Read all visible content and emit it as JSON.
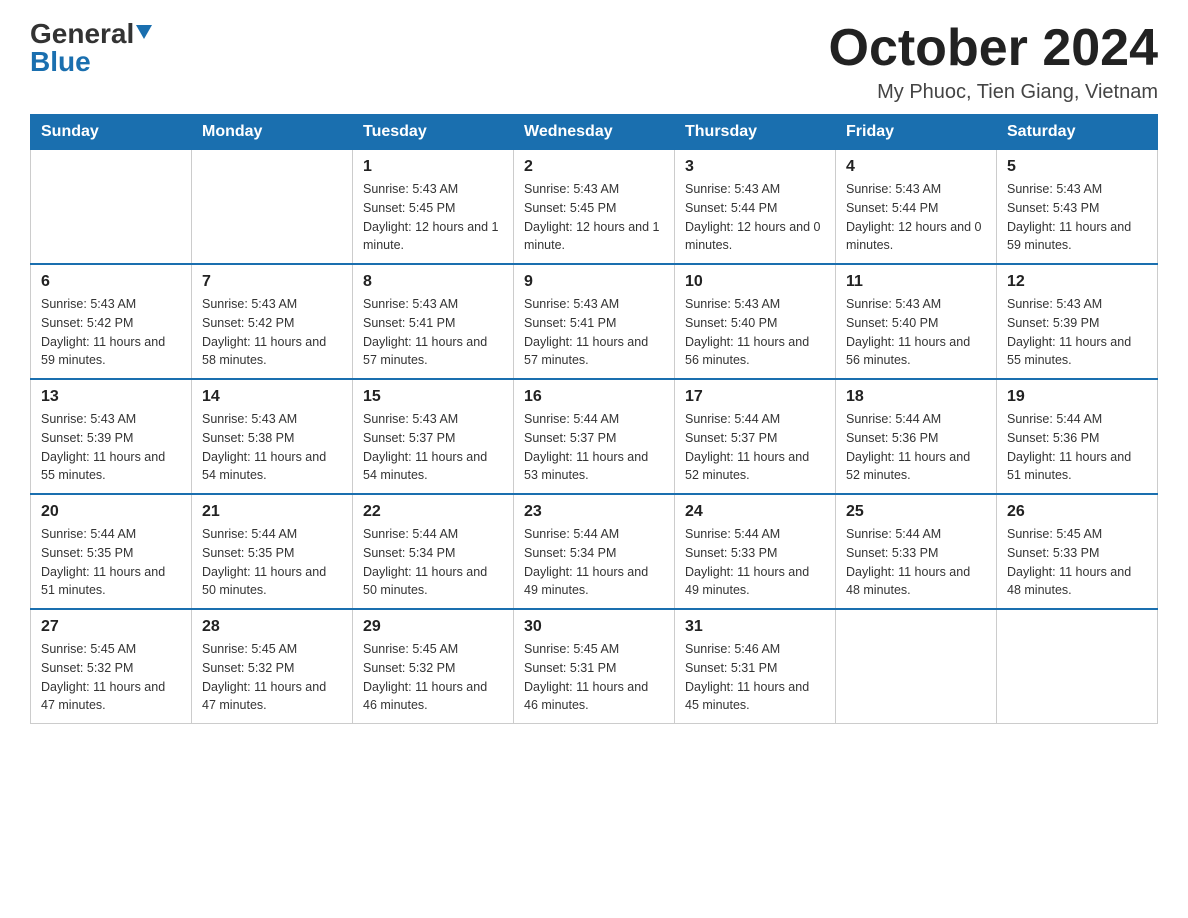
{
  "logo": {
    "general": "General",
    "blue": "Blue"
  },
  "title": "October 2024",
  "location": "My Phuoc, Tien Giang, Vietnam",
  "days_of_week": [
    "Sunday",
    "Monday",
    "Tuesday",
    "Wednesday",
    "Thursday",
    "Friday",
    "Saturday"
  ],
  "weeks": [
    [
      {
        "day": "",
        "info": ""
      },
      {
        "day": "",
        "info": ""
      },
      {
        "day": "1",
        "info": "Sunrise: 5:43 AM\nSunset: 5:45 PM\nDaylight: 12 hours and 1 minute."
      },
      {
        "day": "2",
        "info": "Sunrise: 5:43 AM\nSunset: 5:45 PM\nDaylight: 12 hours and 1 minute."
      },
      {
        "day": "3",
        "info": "Sunrise: 5:43 AM\nSunset: 5:44 PM\nDaylight: 12 hours and 0 minutes."
      },
      {
        "day": "4",
        "info": "Sunrise: 5:43 AM\nSunset: 5:44 PM\nDaylight: 12 hours and 0 minutes."
      },
      {
        "day": "5",
        "info": "Sunrise: 5:43 AM\nSunset: 5:43 PM\nDaylight: 11 hours and 59 minutes."
      }
    ],
    [
      {
        "day": "6",
        "info": "Sunrise: 5:43 AM\nSunset: 5:42 PM\nDaylight: 11 hours and 59 minutes."
      },
      {
        "day": "7",
        "info": "Sunrise: 5:43 AM\nSunset: 5:42 PM\nDaylight: 11 hours and 58 minutes."
      },
      {
        "day": "8",
        "info": "Sunrise: 5:43 AM\nSunset: 5:41 PM\nDaylight: 11 hours and 57 minutes."
      },
      {
        "day": "9",
        "info": "Sunrise: 5:43 AM\nSunset: 5:41 PM\nDaylight: 11 hours and 57 minutes."
      },
      {
        "day": "10",
        "info": "Sunrise: 5:43 AM\nSunset: 5:40 PM\nDaylight: 11 hours and 56 minutes."
      },
      {
        "day": "11",
        "info": "Sunrise: 5:43 AM\nSunset: 5:40 PM\nDaylight: 11 hours and 56 minutes."
      },
      {
        "day": "12",
        "info": "Sunrise: 5:43 AM\nSunset: 5:39 PM\nDaylight: 11 hours and 55 minutes."
      }
    ],
    [
      {
        "day": "13",
        "info": "Sunrise: 5:43 AM\nSunset: 5:39 PM\nDaylight: 11 hours and 55 minutes."
      },
      {
        "day": "14",
        "info": "Sunrise: 5:43 AM\nSunset: 5:38 PM\nDaylight: 11 hours and 54 minutes."
      },
      {
        "day": "15",
        "info": "Sunrise: 5:43 AM\nSunset: 5:37 PM\nDaylight: 11 hours and 54 minutes."
      },
      {
        "day": "16",
        "info": "Sunrise: 5:44 AM\nSunset: 5:37 PM\nDaylight: 11 hours and 53 minutes."
      },
      {
        "day": "17",
        "info": "Sunrise: 5:44 AM\nSunset: 5:37 PM\nDaylight: 11 hours and 52 minutes."
      },
      {
        "day": "18",
        "info": "Sunrise: 5:44 AM\nSunset: 5:36 PM\nDaylight: 11 hours and 52 minutes."
      },
      {
        "day": "19",
        "info": "Sunrise: 5:44 AM\nSunset: 5:36 PM\nDaylight: 11 hours and 51 minutes."
      }
    ],
    [
      {
        "day": "20",
        "info": "Sunrise: 5:44 AM\nSunset: 5:35 PM\nDaylight: 11 hours and 51 minutes."
      },
      {
        "day": "21",
        "info": "Sunrise: 5:44 AM\nSunset: 5:35 PM\nDaylight: 11 hours and 50 minutes."
      },
      {
        "day": "22",
        "info": "Sunrise: 5:44 AM\nSunset: 5:34 PM\nDaylight: 11 hours and 50 minutes."
      },
      {
        "day": "23",
        "info": "Sunrise: 5:44 AM\nSunset: 5:34 PM\nDaylight: 11 hours and 49 minutes."
      },
      {
        "day": "24",
        "info": "Sunrise: 5:44 AM\nSunset: 5:33 PM\nDaylight: 11 hours and 49 minutes."
      },
      {
        "day": "25",
        "info": "Sunrise: 5:44 AM\nSunset: 5:33 PM\nDaylight: 11 hours and 48 minutes."
      },
      {
        "day": "26",
        "info": "Sunrise: 5:45 AM\nSunset: 5:33 PM\nDaylight: 11 hours and 48 minutes."
      }
    ],
    [
      {
        "day": "27",
        "info": "Sunrise: 5:45 AM\nSunset: 5:32 PM\nDaylight: 11 hours and 47 minutes."
      },
      {
        "day": "28",
        "info": "Sunrise: 5:45 AM\nSunset: 5:32 PM\nDaylight: 11 hours and 47 minutes."
      },
      {
        "day": "29",
        "info": "Sunrise: 5:45 AM\nSunset: 5:32 PM\nDaylight: 11 hours and 46 minutes."
      },
      {
        "day": "30",
        "info": "Sunrise: 5:45 AM\nSunset: 5:31 PM\nDaylight: 11 hours and 46 minutes."
      },
      {
        "day": "31",
        "info": "Sunrise: 5:46 AM\nSunset: 5:31 PM\nDaylight: 11 hours and 45 minutes."
      },
      {
        "day": "",
        "info": ""
      },
      {
        "day": "",
        "info": ""
      }
    ]
  ]
}
